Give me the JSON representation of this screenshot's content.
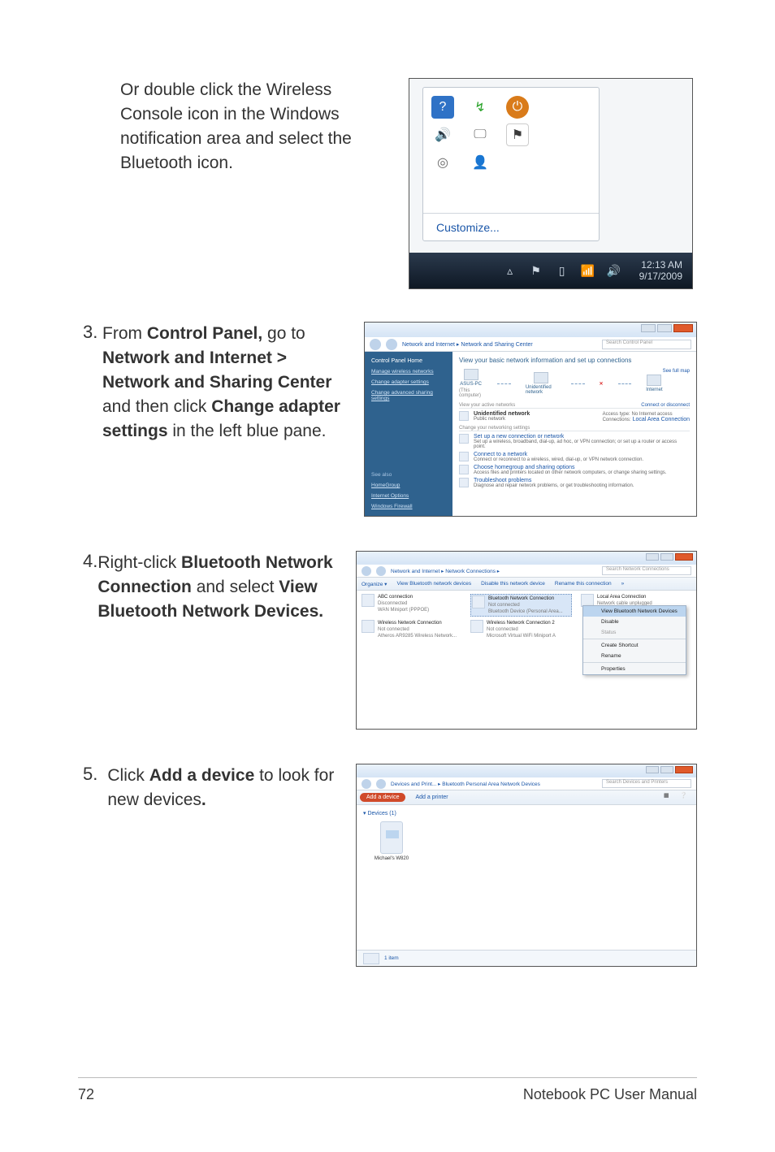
{
  "intro": {
    "text": "Or double click the Wireless Console icon in the Windows notification area and select the Bluetooth icon."
  },
  "steps": {
    "s3": {
      "num": "3.",
      "parts": [
        "From ",
        "Control Panel,",
        " go to ",
        "Network and Internet > Network and Sharing Center",
        " and then click ",
        "Change adapter settings",
        " in the left blue pane."
      ]
    },
    "s4": {
      "num": "4.",
      "parts": [
        "Right-click ",
        "Bluetooth Network Connection",
        " and select ",
        "View Bluetooth Network Devices."
      ]
    },
    "s5": {
      "num": "5.",
      "parts": [
        "Click ",
        "Add a device",
        " to look for new devices",
        "."
      ]
    }
  },
  "shot1": {
    "customize": "Customize...",
    "clock_time": "12:13 AM",
    "clock_date": "9/17/2009"
  },
  "shot2": {
    "breadcrumb": "Network and Internet  ▸  Network and Sharing Center",
    "search_placeholder": "Search Control Panel",
    "sidebar": {
      "header": "Control Panel Home",
      "links": [
        "Manage wireless networks",
        "Change adapter settings",
        "Change advanced sharing settings"
      ],
      "see_also": "See also",
      "see_links": [
        "HomeGroup",
        "Internet Options",
        "Windows Firewall"
      ]
    },
    "main": {
      "heading": "View your basic network information and set up connections",
      "see_full_map": "See full map",
      "nodes": [
        "ASUS-PC",
        "Unidentified network",
        "Internet"
      ],
      "this_computer": "(This computer)",
      "active_hdr": "View your active networks",
      "connect_link": "Connect or disconnect",
      "net_name": "Unidentified network",
      "net_type": "Public network",
      "access_label": "Access type:",
      "access_value": "No Internet access",
      "conn_label": "Connections:",
      "conn_value": "Local Area Connection",
      "change_hdr": "Change your networking settings",
      "tasks": [
        {
          "t": "Set up a new connection or network",
          "d": "Set up a wireless, broadband, dial-up, ad hoc, or VPN connection; or set up a router or access point."
        },
        {
          "t": "Connect to a network",
          "d": "Connect or reconnect to a wireless, wired, dial-up, or VPN network connection."
        },
        {
          "t": "Choose homegroup and sharing options",
          "d": "Access files and printers located on other network computers, or change sharing settings."
        },
        {
          "t": "Troubleshoot problems",
          "d": "Diagnose and repair network problems, or get troubleshooting information."
        }
      ]
    }
  },
  "shot3": {
    "breadcrumb": "Network and Internet  ▸  Network Connections  ▸",
    "search_placeholder": "Search Network Connections",
    "toolbar": [
      "Organize ▾",
      "View Bluetooth network devices",
      "Disable this network device",
      "Rename this connection",
      "»"
    ],
    "connections": [
      {
        "name": "ABC connection",
        "status": "Disconnected",
        "dev": "WAN Miniport (PPPOE)"
      },
      {
        "name": "Wireless Network Connection",
        "status": "Not connected",
        "dev": "Atheros AR9285 Wireless Network..."
      },
      {
        "name": "Bluetooth Network Connection",
        "status": "Not connected",
        "dev": "Bluetooth Device (Personal Area..."
      },
      {
        "name": "Wireless Network Connection 2",
        "status": "Not connected",
        "dev": "Microsoft Virtual WiFi Miniport A"
      },
      {
        "name": "Local Area Connection",
        "status": "Network cable unplugged",
        "dev": ""
      }
    ],
    "context_menu": [
      "View Bluetooth Network Devices",
      "Disable",
      "Status",
      "Create Shortcut",
      "Rename",
      "Properties"
    ]
  },
  "shot4": {
    "breadcrumb": "Devices and Print...  ▸  Bluetooth Personal Area Network Devices",
    "search_placeholder": "Search Devices and Printers",
    "toolbar": {
      "add_device": "Add a device",
      "add_printer": "Add a printer"
    },
    "category": "▾ Devices (1)",
    "device_name": "Michael's W820",
    "footer_text": "1 item"
  },
  "footer": {
    "page": "72",
    "title": "Notebook PC User Manual"
  }
}
